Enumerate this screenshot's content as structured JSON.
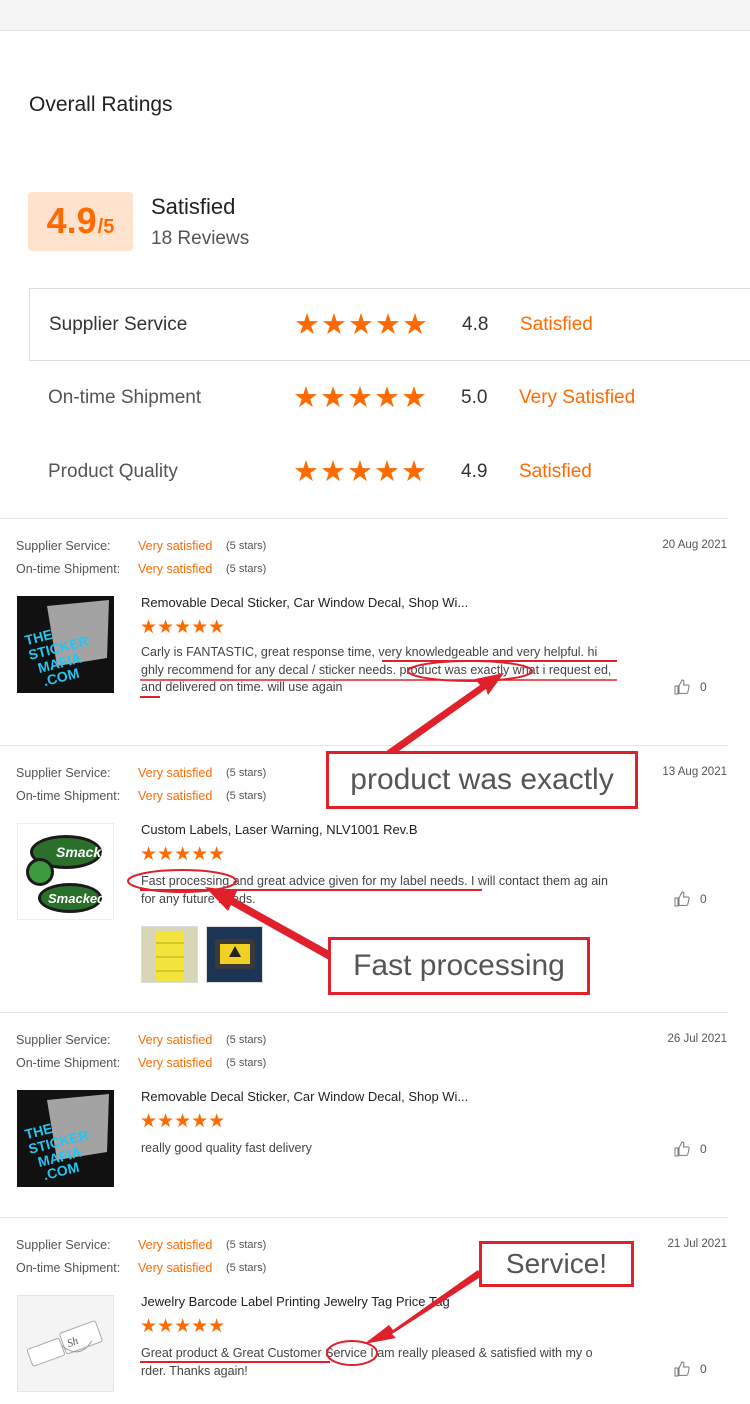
{
  "overall": {
    "title": "Overall Ratings",
    "score": "4.9",
    "score_denominator": "/5",
    "satisfaction": "Satisfied",
    "reviews": "18 Reviews"
  },
  "rating_rows": [
    {
      "label": "Supplier Service",
      "stars": "★★★★★",
      "score": "4.8",
      "text": "Satisfied"
    },
    {
      "label": "On-time Shipment",
      "stars": "★★★★★",
      "score": "5.0",
      "text": "Very Satisfied"
    },
    {
      "label": "Product Quality",
      "stars": "★★★★★",
      "score": "4.9",
      "text": "Satisfied"
    }
  ],
  "meta_labels": {
    "supplier_service": "Supplier Service:",
    "on_time_shipment": "On-time Shipment:",
    "very_satisfied": "Very satisfied",
    "five_stars": "(5 stars)"
  },
  "reviews": [
    {
      "date": "20 Aug 2021",
      "product": "Removable Decal Sticker, Car Window Decal, Shop Wi...",
      "stars": "★★★★★",
      "text": "Carly is FANTASTIC, great response time, very knowledgeable and very helpful.  hi ghly recommend for any decal / sticker needs. product was exactly what i request ed, and delivered on time. will use again",
      "likes": "0",
      "thumb_text": "THE STICKER MAFIA .COM"
    },
    {
      "date": "13 Aug 2021",
      "product": "Custom Labels, Laser Warning, NLV1001 Rev.B",
      "stars": "★★★★★",
      "text": "Fast processing and great advice given for my label needs.  I will contact them ag ain for any future needs.",
      "likes": "0",
      "thumb_text": "Smacked"
    },
    {
      "date": "26 Jul 2021",
      "product": "Removable Decal Sticker, Car Window Decal, Shop Wi...",
      "stars": "★★★★★",
      "text": "really good quality fast delivery",
      "likes": "0",
      "thumb_text": "THE STICKER MAFIA .COM"
    },
    {
      "date": "21 Jul 2021",
      "product": "Jewelry Barcode Label Printing Jewelry Tag Price Tag",
      "stars": "★★★★★",
      "text": "Great product & Great Customer Service I am really pleased & satisfied with my o rder. Thanks again!",
      "likes": "0",
      "thumb_text": "Sh"
    }
  ],
  "callouts": {
    "c1": "product was exactly",
    "c2": "Fast processing",
    "c3": "Service!"
  },
  "colors": {
    "accent": "#ff6a00",
    "annotation_red": "#e0202a"
  }
}
